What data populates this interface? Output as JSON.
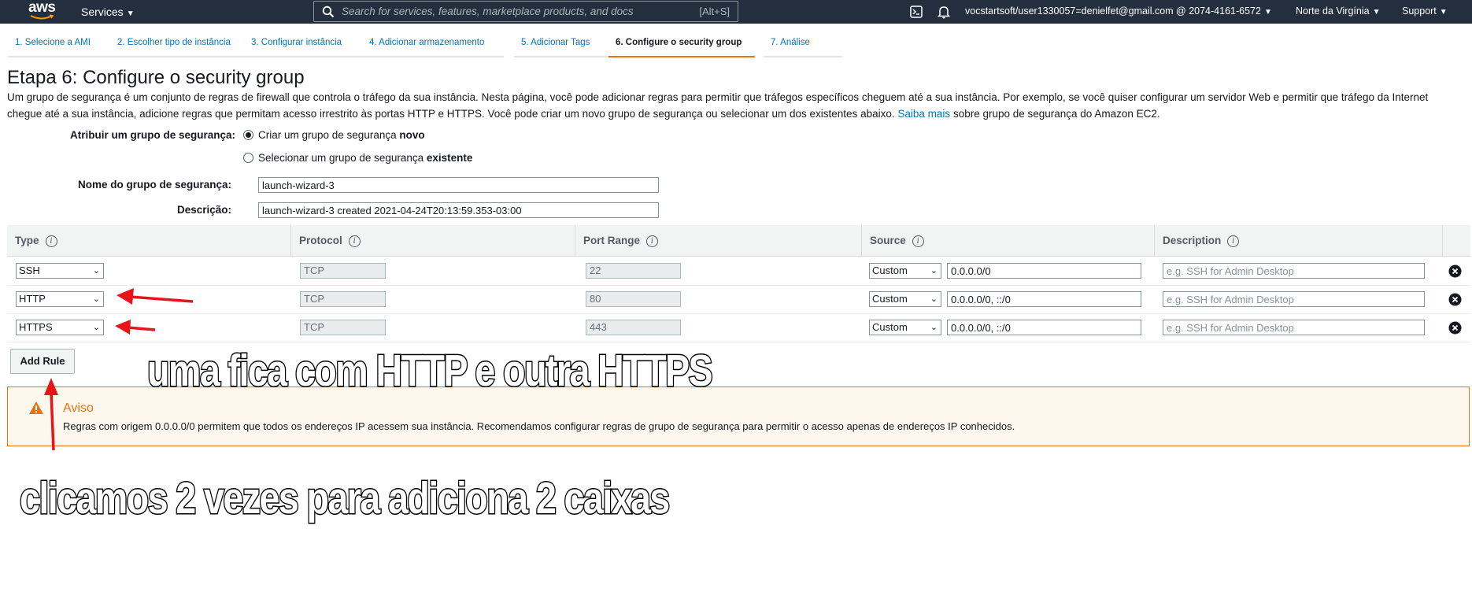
{
  "nav": {
    "logo": "aws",
    "services": "Services",
    "search_placeholder": "Search for services, features, marketplace products, and docs",
    "search_shortcut": "[Alt+S]",
    "account": "vocstartsoft/user1330057=denielfet@gmail.com @ 2074-4161-6572",
    "region": "Norte da Virgínia",
    "support": "Support"
  },
  "steps": [
    {
      "label": "1. Selecione a AMI"
    },
    {
      "label": "2. Escolher tipo de instância"
    },
    {
      "label": "3. Configurar instância"
    },
    {
      "label": "4. Adicionar armazenamento"
    },
    {
      "label": "5. Adicionar Tags"
    },
    {
      "label": "6. Configure o security group"
    },
    {
      "label": "7. Análise"
    }
  ],
  "page": {
    "title": "Etapa 6: Configure o security group",
    "intro_1": "Um grupo de segurança é um conjunto de regras de firewall que controla o tráfego da sua instância. Nesta página, você pode adicionar regras para permitir que tráfegos específicos cheguem até a sua instância. Por exemplo, se você quiser configurar um servidor Web e permitir que tráfego da Internet chegue até a sua instância, adicione regras que permitam acesso irrestrito às portas HTTP e HTTPS. Você pode criar um novo grupo de segurança ou selecionar um dos existentes abaixo.",
    "intro_link": "Saiba mais",
    "intro_2": "sobre grupo de segurança do Amazon EC2."
  },
  "form": {
    "assign_label": "Atribuir um grupo de segurança:",
    "opt_new_prefix": "Criar um grupo de segurança",
    "opt_new_bold": "novo",
    "opt_existing_prefix": "Selecionar um grupo de segurança",
    "opt_existing_bold": "existente",
    "name_label": "Nome do grupo de segurança:",
    "name_value": "launch-wizard-3",
    "desc_label": "Descrição:",
    "desc_value": "launch-wizard-3 created 2021-04-24T20:13:59.353-03:00"
  },
  "table": {
    "headers": [
      "Type",
      "Protocol",
      "Port Range",
      "Source",
      "Description"
    ],
    "rows": [
      {
        "type": "SSH",
        "protocol": "TCP",
        "port": "22",
        "source_type": "Custom",
        "source": "0.0.0.0/0",
        "description_placeholder": "e.g. SSH for Admin Desktop"
      },
      {
        "type": "HTTP",
        "protocol": "TCP",
        "port": "80",
        "source_type": "Custom",
        "source": "0.0.0.0/0, ::/0",
        "description_placeholder": "e.g. SSH for Admin Desktop"
      },
      {
        "type": "HTTPS",
        "protocol": "TCP",
        "port": "443",
        "source_type": "Custom",
        "source": "0.0.0.0/0, ::/0",
        "description_placeholder": "e.g. SSH for Admin Desktop"
      }
    ],
    "add_rule": "Add Rule"
  },
  "warning": {
    "title": "Aviso",
    "text": "Regras com origem 0.0.0.0/0 permitem que todos os endereços IP acessem sua instância. Recomendamos configurar regras de grupo de segurança para permitir o acesso apenas de endereços IP conhecidos."
  },
  "annotations": {
    "caption_1": "uma fica com HTTP e outra HTTPS",
    "caption_2": "clicamos 2 vezes para adiciona 2 caixas",
    "arrow_color": "#e8141c"
  },
  "colors": {
    "nav_bg": "#232f3e",
    "link": "#0073bb",
    "accent": "#ec7211"
  }
}
